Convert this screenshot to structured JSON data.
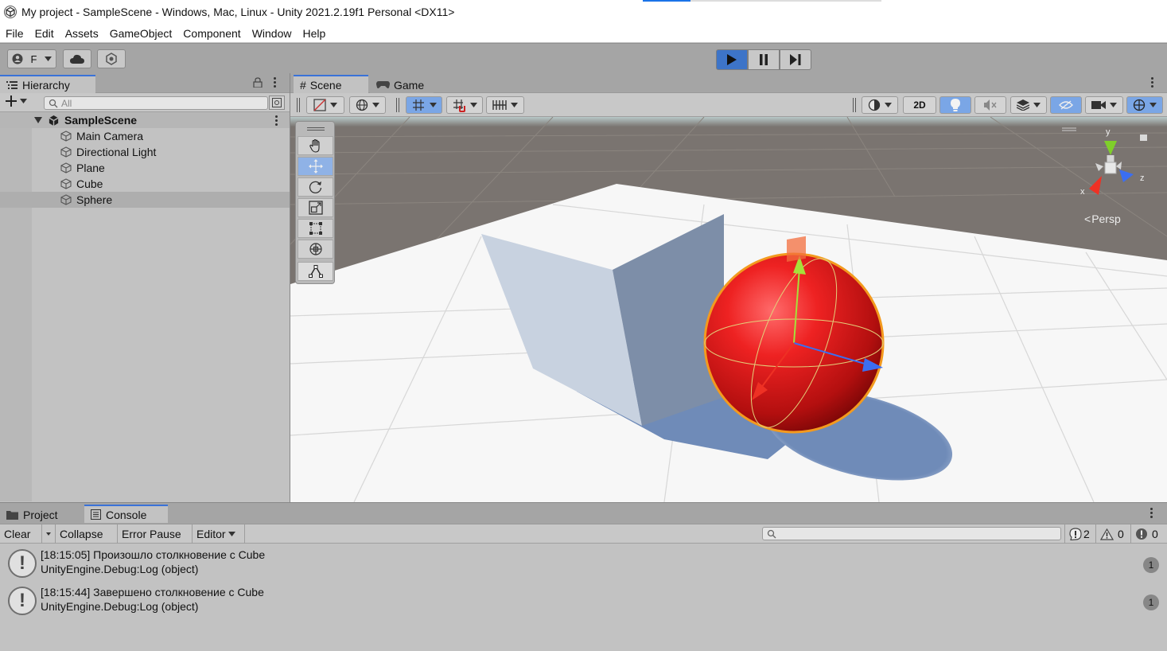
{
  "window": {
    "title": "My project - SampleScene - Windows, Mac, Linux - Unity 2021.2.19f1 Personal <DX11>"
  },
  "menu": [
    "File",
    "Edit",
    "Assets",
    "GameObject",
    "Component",
    "Window",
    "Help"
  ],
  "toolbar": {
    "account_label": "F"
  },
  "hierarchy": {
    "tab_label": "Hierarchy",
    "search_placeholder": "All",
    "scene_name": "SampleScene",
    "items": [
      "Main Camera",
      "Directional Light",
      "Plane",
      "Cube",
      "Sphere"
    ],
    "selected": "Sphere"
  },
  "scene_view": {
    "tabs": [
      "Scene",
      "Game"
    ],
    "active_tab": "Scene",
    "two_d_label": "2D",
    "gizmo": {
      "x_label": "x",
      "y_label": "y",
      "z_label": "z",
      "projection": "Persp"
    }
  },
  "bottom": {
    "tabs": [
      "Project",
      "Console"
    ],
    "active_tab": "Console",
    "buttons": {
      "clear": "Clear",
      "collapse": "Collapse",
      "error_pause": "Error Pause",
      "editor": "Editor"
    },
    "counts": {
      "info": "2",
      "warnings": "0",
      "errors": "0"
    },
    "logs": [
      {
        "line1": "[18:15:05] Произошло столкновение с Cube",
        "line2": "UnityEngine.Debug:Log (object)",
        "count": "1"
      },
      {
        "line1": "[18:15:44] Завершено столкновение с Cube",
        "line2": "UnityEngine.Debug:Log (object)",
        "count": "1"
      }
    ]
  },
  "colors": {
    "accent": "#3d74c8",
    "sphere": "#e02020",
    "selection_outline": "#f39a1e"
  }
}
